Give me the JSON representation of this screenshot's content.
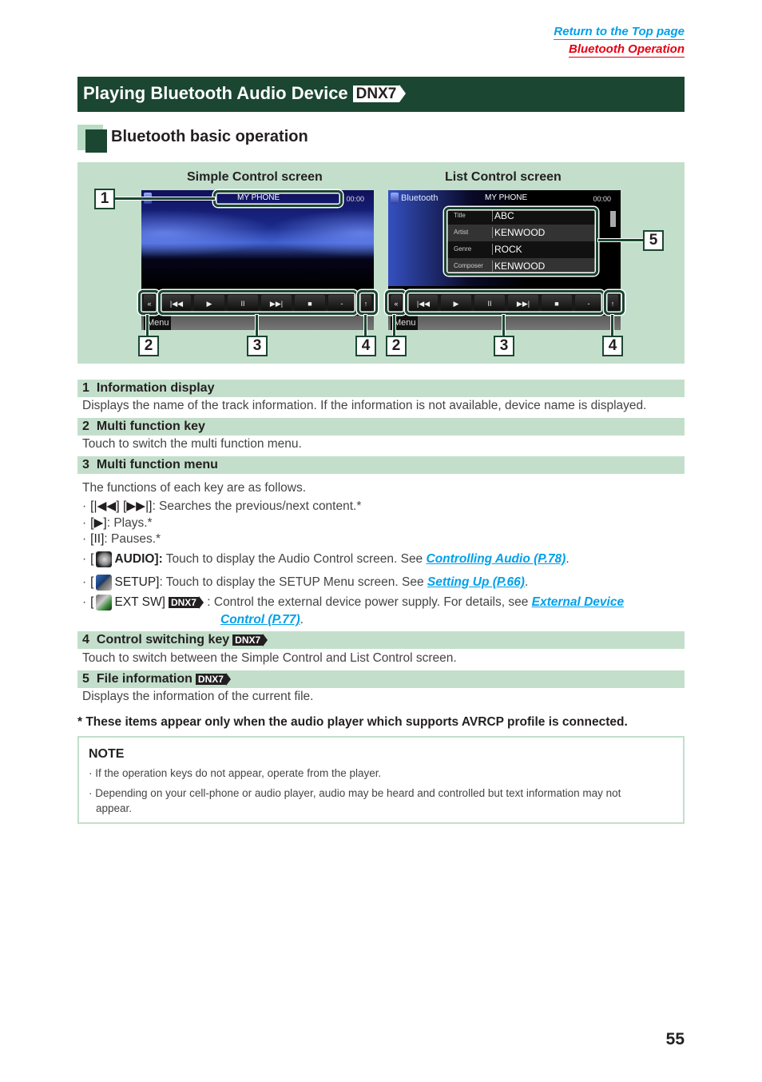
{
  "nav": {
    "return_top": "Return to the Top page",
    "section_link": "Bluetooth Operation",
    "colors": {
      "link_blue": "#00a0e9",
      "link_red": "#e60012"
    }
  },
  "header": {
    "title": "Playing Bluetooth Audio Device",
    "model_badge": "DNX7",
    "bar_color": "#1b4632"
  },
  "subsection": {
    "title": "Bluetooth basic operation"
  },
  "figure": {
    "simple_label": "Simple Control screen",
    "list_label": "List Control screen",
    "simple_screen": {
      "device_name": "MY PHONE",
      "time": "00:00",
      "menu_tab": "Menu",
      "keys": [
        "|◀◀",
        "▶",
        "II",
        "▶▶|",
        "■",
        "-"
      ],
      "multi_key": "«",
      "switch_key": "↑"
    },
    "list_screen": {
      "source": "Bluetooth",
      "device_name": "MY PHONE",
      "time": "00:00",
      "menu_tab": "Menu",
      "file_info": [
        {
          "key": "Title",
          "value": "ABC"
        },
        {
          "key": "Artist",
          "value": "KENWOOD"
        },
        {
          "key": "Genre",
          "value": "ROCK"
        },
        {
          "key": "Composer",
          "value": "KENWOOD"
        }
      ],
      "keys": [
        "|◀◀",
        "▶",
        "II",
        "▶▶|",
        "■",
        "-"
      ],
      "multi_key": "«",
      "switch_key": "↑"
    },
    "callouts": [
      "1",
      "2",
      "3",
      "4",
      "5"
    ]
  },
  "items": [
    {
      "num": "1",
      "title": "Information display",
      "badge": "",
      "desc": "Displays the name of the track information. If the information is not available, device name is displayed."
    },
    {
      "num": "2",
      "title": "Multi function key",
      "badge": "",
      "desc": "Touch to switch the multi function menu."
    },
    {
      "num": "3",
      "title": "Multi function menu",
      "badge": "",
      "desc": "The functions of each key are as follows."
    },
    {
      "num": "4",
      "title": "Control switching key",
      "badge": "DNX7",
      "desc": "Touch to switch between the Simple Control and List Control screen."
    },
    {
      "num": "5",
      "title": "File information",
      "badge": "DNX7",
      "desc": "Displays the information of the current file."
    }
  ],
  "menu_functions": [
    {
      "key": "[|◀◀] [▶▶|]",
      "text": ": Searches the previous/next content.*"
    },
    {
      "key": "[▶]",
      "text": ": Plays.*"
    },
    {
      "key": "[II]",
      "text": ": Pauses.*"
    },
    {
      "key_pre": "[",
      "icon": "audio-icon",
      "key_post": "AUDIO]:",
      "text": " Touch to display the Audio Control screen. See ",
      "link": "Controlling Audio (P.78)",
      "tail": "."
    },
    {
      "key_pre": "[",
      "icon": "setup-icon",
      "key_post": "SETUP]",
      "text": ": Touch to display the SETUP Menu screen. See ",
      "link": "Setting Up (P.66)",
      "tail": "."
    },
    {
      "key_pre": "[",
      "icon": "ext-sw-icon",
      "key_post": "EXT SW]",
      "badge": "DNX7",
      "text": " : Control the external device power supply. For details, see ",
      "link": "External Device",
      "link2": "Control (P.77)",
      "tail": "."
    }
  ],
  "footnote": "* These items appear only when the audio player which supports AVRCP profile is connected.",
  "note": {
    "title": "NOTE",
    "items": [
      "If the operation keys do not appear, operate from the player.",
      "Depending on your cell-phone or audio player, audio may be heard and controlled but text information may not",
      "appear."
    ]
  },
  "page_number": "55"
}
